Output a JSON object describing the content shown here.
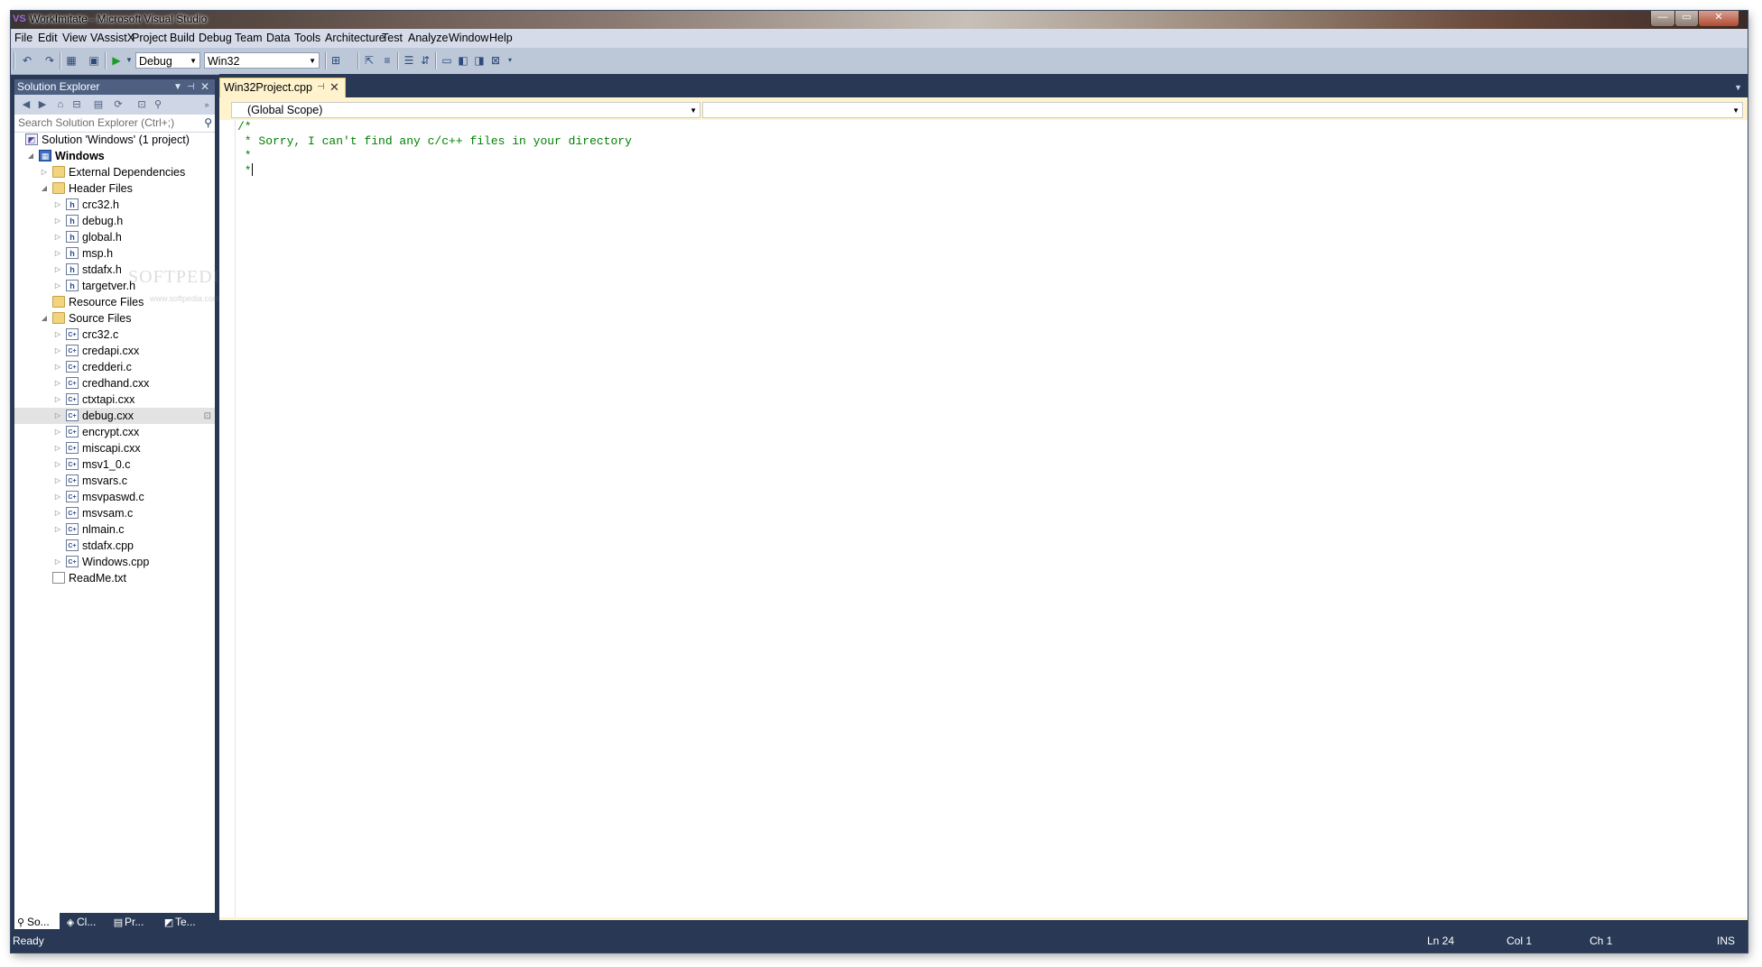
{
  "window": {
    "title": "WorkImitate - Microsoft Visual Studio",
    "logo": "VS",
    "buttons": {
      "minimize": "—",
      "maximize": "▭",
      "close": "✕"
    }
  },
  "menu": [
    "File",
    "Edit",
    "View",
    "VAssistX",
    "Project",
    "Build",
    "Debug",
    "Team",
    "Data",
    "Tools",
    "Architecture",
    "Test",
    "Analyze",
    "Window",
    "Help"
  ],
  "toolbar": {
    "config": "Debug",
    "platform": "Win32"
  },
  "solution_explorer": {
    "title": "Solution Explorer",
    "search_placeholder": "Search Solution Explorer (Ctrl+;)",
    "items": [
      {
        "label": "Solution 'Windows' (1 project)",
        "kind": "solution",
        "level": 0,
        "expand": ""
      },
      {
        "label": "Windows",
        "kind": "project",
        "level": 1,
        "expand": "◢",
        "bold": true
      },
      {
        "label": "External Dependencies",
        "kind": "folder",
        "level": 2,
        "expand": "▷"
      },
      {
        "label": "Header Files",
        "kind": "folder",
        "level": 2,
        "expand": "◢"
      },
      {
        "label": "crc32.h",
        "kind": "h",
        "level": 3,
        "expand": "▷"
      },
      {
        "label": "debug.h",
        "kind": "h",
        "level": 3,
        "expand": "▷"
      },
      {
        "label": "global.h",
        "kind": "h",
        "level": 3,
        "expand": "▷"
      },
      {
        "label": "msp.h",
        "kind": "h",
        "level": 3,
        "expand": "▷"
      },
      {
        "label": "stdafx.h",
        "kind": "h",
        "level": 3,
        "expand": "▷"
      },
      {
        "label": "targetver.h",
        "kind": "h",
        "level": 3,
        "expand": "▷"
      },
      {
        "label": "Resource Files",
        "kind": "folder",
        "level": 2,
        "expand": ""
      },
      {
        "label": "Source Files",
        "kind": "folder",
        "level": 2,
        "expand": "◢"
      },
      {
        "label": "crc32.c",
        "kind": "c",
        "level": 3,
        "expand": "▷"
      },
      {
        "label": "credapi.cxx",
        "kind": "c",
        "level": 3,
        "expand": "▷"
      },
      {
        "label": "credderi.c",
        "kind": "c",
        "level": 3,
        "expand": "▷"
      },
      {
        "label": "credhand.cxx",
        "kind": "c",
        "level": 3,
        "expand": "▷"
      },
      {
        "label": "ctxtapi.cxx",
        "kind": "c",
        "level": 3,
        "expand": "▷"
      },
      {
        "label": "debug.cxx",
        "kind": "c",
        "level": 3,
        "expand": "▷",
        "selected": true
      },
      {
        "label": "encrypt.cxx",
        "kind": "c",
        "level": 3,
        "expand": "▷"
      },
      {
        "label": "miscapi.cxx",
        "kind": "c",
        "level": 3,
        "expand": "▷"
      },
      {
        "label": "msv1_0.c",
        "kind": "c",
        "level": 3,
        "expand": "▷"
      },
      {
        "label": "msvars.c",
        "kind": "c",
        "level": 3,
        "expand": "▷"
      },
      {
        "label": "msvpaswd.c",
        "kind": "c",
        "level": 3,
        "expand": "▷"
      },
      {
        "label": "msvsam.c",
        "kind": "c",
        "level": 3,
        "expand": "▷"
      },
      {
        "label": "nlmain.c",
        "kind": "c",
        "level": 3,
        "expand": "▷"
      },
      {
        "label": "stdafx.cpp",
        "kind": "c",
        "level": 3,
        "expand": ""
      },
      {
        "label": "Windows.cpp",
        "kind": "c",
        "level": 3,
        "expand": "▷"
      },
      {
        "label": "ReadMe.txt",
        "kind": "txt",
        "level": 2,
        "expand": ""
      }
    ],
    "tabs": [
      "So...",
      "Cl...",
      "Pr...",
      "Te..."
    ]
  },
  "editor": {
    "tab_label": "Win32Project.cpp",
    "scope": "(Global Scope)",
    "member": "",
    "code_lines": [
      "/*",
      " * Sorry, I can't find any c/c++ files in your directory",
      " *",
      " *"
    ]
  },
  "watermark": {
    "text": "SOFTPEDIA",
    "sub": "www.softpedia.com"
  },
  "status": {
    "ready": "Ready",
    "ln": "Ln 24",
    "col": "Col 1",
    "ch": "Ch 1",
    "ins": "INS"
  }
}
